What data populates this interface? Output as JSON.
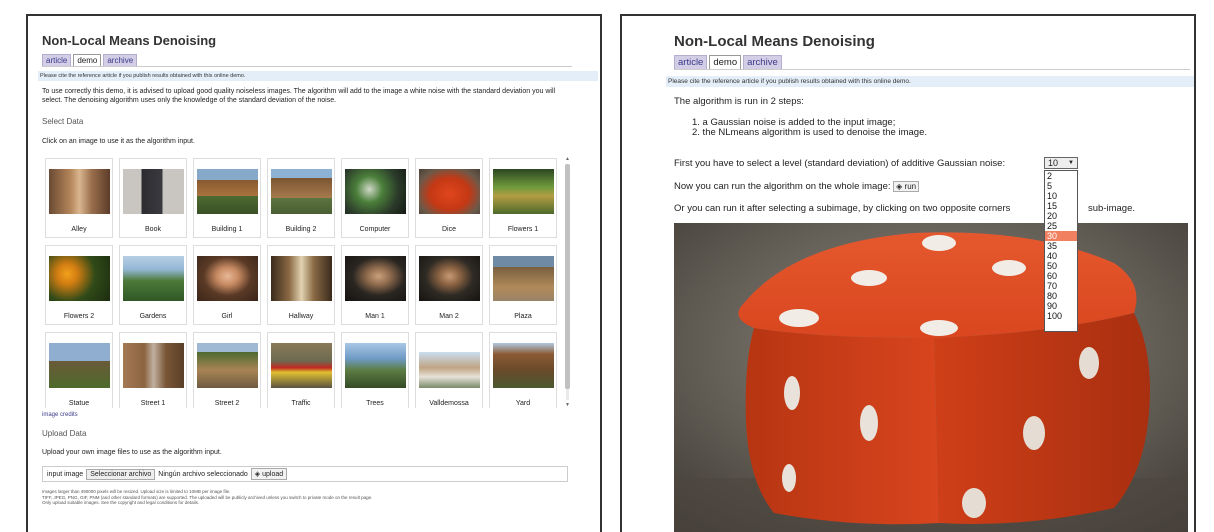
{
  "left": {
    "title": "Non-Local Means Denoising",
    "tabs": [
      "article",
      "demo",
      "archive"
    ],
    "cite": "Please cite the reference article if you publish results obtained with this online demo.",
    "intro": "To use correctly this demo, it is advised to upload good quality noiseless images. The algorithm will add to the image a white noise with the standard deviation you will select. The denoising algorithm uses only the knowledge of the standard deviation of the noise.",
    "select_heading": "Select Data",
    "select_instruction": "Click on an image to use it as the algorithm input.",
    "gallery": [
      "Alley",
      "Book",
      "Building 1",
      "Building 2",
      "Computer",
      "Dice",
      "Flowers 1",
      "Flowers 2",
      "Gardens",
      "Girl",
      "Hallway",
      "Man 1",
      "Man 2",
      "Plaza",
      "Statue",
      "Street 1",
      "Street 2",
      "Traffic",
      "Trees",
      "Valldemossa",
      "Yard"
    ],
    "image_credits": "image credits",
    "upload_heading": "Upload Data",
    "upload_instruction": "Upload your own image files to use as the algorithm input.",
    "input_label": "input image",
    "file_button": "Seleccionar archivo",
    "file_status": "Ningún archivo seleccionado",
    "upload_button": "upload",
    "fine_print": [
      "Images larger than 490000 pixels will be resized. Upload size is limited to 10MB per image file.",
      "TIFF, JPEG, PNG, GIF, PNM (and other standard formats) are supported. The uploaded will be publicly archived unless you switch to private mode on the result page.",
      "Only upload suitable images. See the copyright and legal conditions for details."
    ]
  },
  "right": {
    "title": "Non-Local Means Denoising",
    "tabs": [
      "article",
      "demo",
      "archive"
    ],
    "cite": "Please cite the reference article if you publish results obtained with this online demo.",
    "steps_intro": "The algorithm is run in 2 steps:",
    "step1": "1. a Gaussian noise is added to the input image;",
    "step2": "2. the NLmeans algorithm is used to denoise the image.",
    "level_label": "First you have to select a level (standard deviation) of additive Gaussian noise:",
    "level_value": "10",
    "level_options": [
      "2",
      "5",
      "10",
      "15",
      "20",
      "25",
      "30",
      "35",
      "40",
      "50",
      "60",
      "70",
      "80",
      "90",
      "100"
    ],
    "highlighted_option": "30",
    "run_label": "Now you can run the algorithm on the whole image:",
    "run_button": "run",
    "subimage_a": "Or you can run it after selecting a subimage, by clicking on two opposite corners",
    "subimage_b": "sub-image."
  },
  "colors": {
    "tab_bg": "#d3cde6",
    "cite_bg": "#e4eef8",
    "highlight": "#f08060",
    "dice": "#d9461f"
  }
}
